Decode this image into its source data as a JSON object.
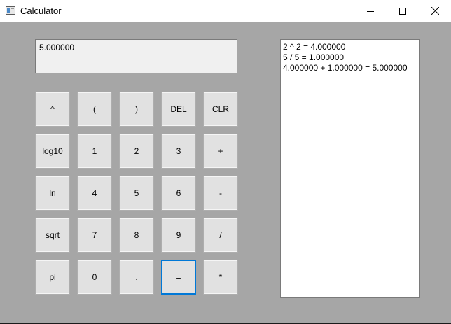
{
  "window": {
    "title": "Calculator"
  },
  "display": {
    "value": "5.000000"
  },
  "history": {
    "lines": [
      "2 ^ 2 = 4.000000",
      "5 / 5 = 1.000000",
      "4.000000 + 1.000000 = 5.000000"
    ]
  },
  "keys": [
    [
      "^",
      "(",
      ")",
      "DEL",
      "CLR"
    ],
    [
      "log10",
      "1",
      "2",
      "3",
      "+"
    ],
    [
      "ln",
      "4",
      "5",
      "6",
      "-"
    ],
    [
      "sqrt",
      "7",
      "8",
      "9",
      "/"
    ],
    [
      "pi",
      "0",
      ".",
      "=",
      "*"
    ]
  ],
  "focused_key": "=",
  "colors": {
    "client_background": "#a6a6a6",
    "button_face": "#e1e1e1",
    "focus_border": "#0078d7"
  },
  "icons": {
    "app": "calculator-app-icon",
    "minimize": "minimize-icon",
    "maximize": "maximize-icon",
    "close": "close-icon"
  }
}
